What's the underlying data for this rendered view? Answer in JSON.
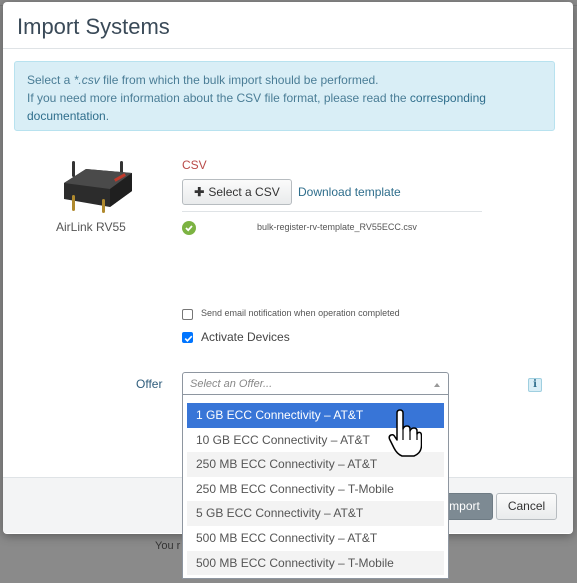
{
  "modal": {
    "title": "Import Systems",
    "info": {
      "line1_pre": "Select a ",
      "line1_ext": "*.csv",
      "line1_post": " file from which the bulk import should be performed.",
      "line2_pre": "If you need more information about the CSV file format, please read the ",
      "line2_link": "corresponding",
      "line3_link": "documentation",
      "line3_post": "."
    },
    "device": {
      "name": "AirLink RV55",
      "icon": "router-icon"
    },
    "csv": {
      "label": "CSV",
      "select_button": "Select a CSV",
      "select_icon": "plus-icon",
      "download_link": "Download template",
      "file_name": "bulk-register-rv-template_RV55ECC.csv",
      "file_status_icon": "check-circle-icon"
    },
    "options": {
      "email_notification": {
        "label": "Send email notification when operation completed",
        "checked": false
      },
      "activate_devices": {
        "label": "Activate Devices",
        "checked": true
      }
    },
    "offer": {
      "label": "Offer",
      "placeholder": "Select an Offer...",
      "info_icon": "i",
      "options": [
        "1 GB ECC Connectivity – AT&T",
        "10 GB ECC Connectivity – AT&T",
        "250 MB ECC Connectivity – AT&T",
        "250 MB ECC Connectivity – T-Mobile",
        "5 GB ECC Connectivity – AT&T",
        "500 MB ECC Connectivity – AT&T",
        "500 MB ECC Connectivity – T-Mobile"
      ],
      "highlighted_index": 0
    },
    "footer": {
      "import_visible": "mport",
      "cancel": "Cancel"
    }
  },
  "background": {
    "partial_text": "You r"
  },
  "colors": {
    "accent": "#3875d7",
    "alert_bg": "#d9eef6",
    "csv_label": "#b94a48",
    "link": "#2f6e8c",
    "success": "#7cb342"
  }
}
